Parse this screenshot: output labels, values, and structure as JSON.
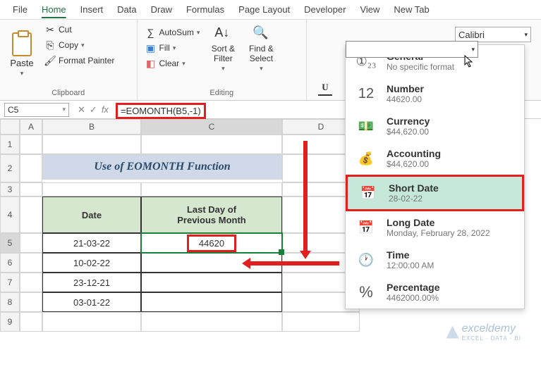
{
  "menu": [
    "File",
    "Home",
    "Insert",
    "Data",
    "Draw",
    "Formulas",
    "Page Layout",
    "Developer",
    "View",
    "New Tab"
  ],
  "active_menu": "Home",
  "ribbon": {
    "paste": "Paste",
    "cut": "Cut",
    "copy": "Copy",
    "fmtpainter": "Format Painter",
    "clipboard_label": "Clipboard",
    "autosum": "AutoSum",
    "fill": "Fill",
    "clear": "Clear",
    "editing_label": "Editing",
    "sortfilter": "Sort & Filter",
    "findselect": "Find & Select",
    "font_name": "Calibri",
    "underline": "U"
  },
  "namebox": "C5",
  "formula": "=EOMONTH(B5,-1)",
  "numfmt": [
    {
      "icon": "123",
      "title": "General",
      "sub": "No specific format"
    },
    {
      "icon": "12",
      "title": "Number",
      "sub": "44620.00"
    },
    {
      "icon": "cur",
      "title": "Currency",
      "sub": "$44,620.00"
    },
    {
      "icon": "acc",
      "title": "Accounting",
      "sub": "$44,620.00"
    },
    {
      "icon": "cal",
      "title": "Short Date",
      "sub": "28-02-22"
    },
    {
      "icon": "cal",
      "title": "Long Date",
      "sub": "Monday, February 28, 2022"
    },
    {
      "icon": "clk",
      "title": "Time",
      "sub": "12:00:00 AM"
    },
    {
      "icon": "pct",
      "title": "Percentage",
      "sub": "4462000.00%"
    }
  ],
  "sheet": {
    "title": "Use of EOMONTH Function",
    "headers": {
      "date": "Date",
      "ldpm1": "Last Day of",
      "ldpm2": "Previous Month"
    },
    "rows": [
      {
        "date": "21-03-22",
        "val": "44620"
      },
      {
        "date": "10-02-22",
        "val": ""
      },
      {
        "date": "23-12-21",
        "val": ""
      },
      {
        "date": "03-01-22",
        "val": ""
      }
    ]
  },
  "watermark": "exceldemy",
  "watermark_sub": "EXCEL · DATA · BI"
}
